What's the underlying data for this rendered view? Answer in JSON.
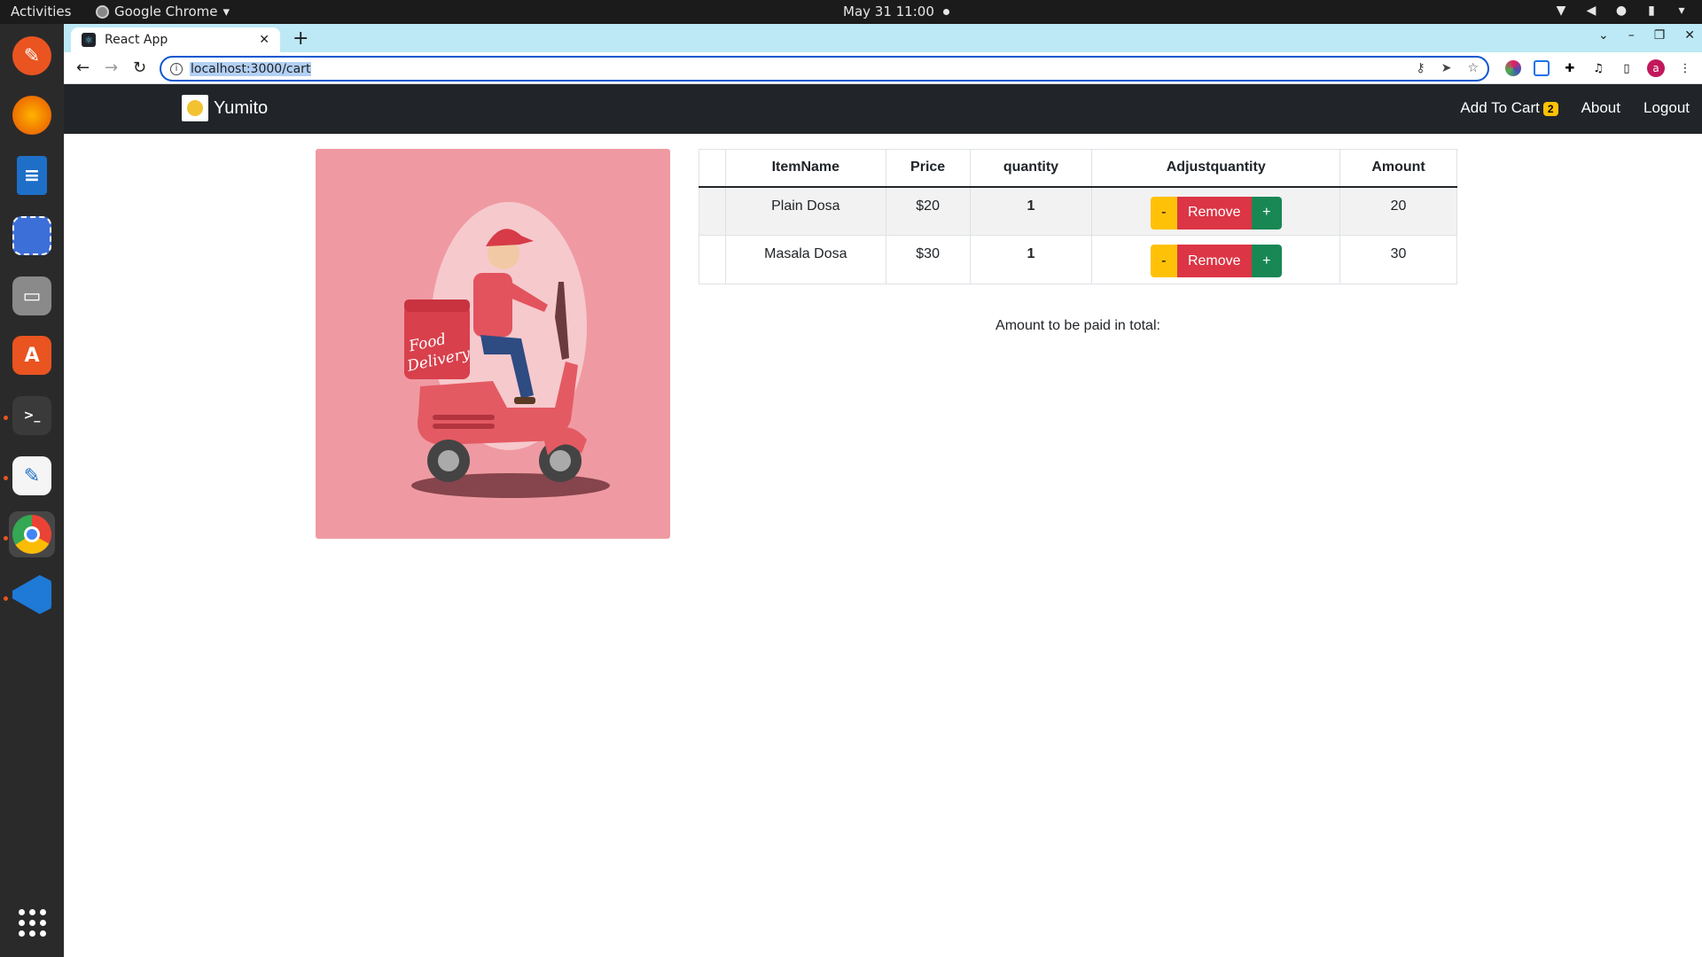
{
  "system": {
    "activities": "Activities",
    "app_name": "Google Chrome",
    "clock": "May 31  11:00"
  },
  "browser": {
    "tab_title": "React App",
    "url": "localhost:3000/cart",
    "avatar_letter": "a"
  },
  "app": {
    "brand": "Yumito",
    "nav": {
      "cart_label": "Add To Cart",
      "cart_count": "2",
      "about": "About",
      "logout": "Logout"
    },
    "hero_text_1": "Food",
    "hero_text_2": "Delivery",
    "table": {
      "headers": [
        "",
        "ItemName",
        "Price",
        "quantity",
        "Adjustquantity",
        "Amount"
      ],
      "rows": [
        {
          "name": "Plain Dosa",
          "price": "$20",
          "quantity": "1",
          "amount": "20"
        },
        {
          "name": "Masala Dosa",
          "price": "$30",
          "quantity": "1",
          "amount": "30"
        }
      ],
      "btn_minus": "-",
      "btn_remove": "Remove",
      "btn_plus": "+"
    },
    "total_text": "Amount to be paid in total:"
  },
  "colors": {
    "navbar": "#212529",
    "hero_bg": "#ef9aa2",
    "warning": "#ffc107",
    "danger": "#dc3545",
    "success": "#198754"
  }
}
